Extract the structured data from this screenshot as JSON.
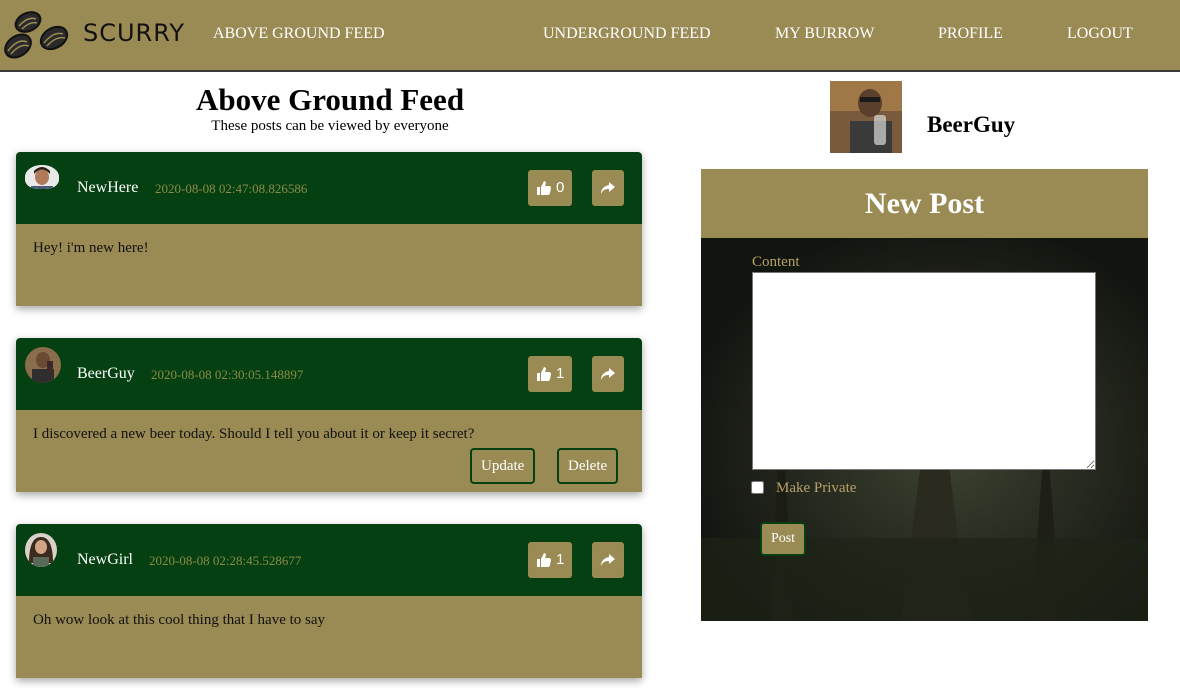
{
  "nav": {
    "brand": "SCURRY",
    "links": [
      "ABOVE GROUND FEED",
      "UNDERGROUND FEED",
      "MY BURROW",
      "PROFILE",
      "LOGOUT"
    ]
  },
  "feed": {
    "title": "Above Ground Feed",
    "subtitle": "These posts can be viewed by everyone"
  },
  "posts": [
    {
      "user": "NewHere",
      "date": "2020-08-08 02:47:08.826586",
      "likes": "0",
      "content": "Hey! i'm new here!"
    },
    {
      "user": "BeerGuy",
      "date": "2020-08-08 02:30:05.148897",
      "likes": "1",
      "content": "I discovered a new beer today. Should I tell you about it or keep it secret?",
      "update_label": "Update",
      "delete_label": "Delete"
    },
    {
      "user": "NewGirl",
      "date": "2020-08-08 02:28:45.528677",
      "likes": "1",
      "content": "Oh wow look at this cool thing that I have to say"
    }
  ],
  "profile": {
    "name": "BeerGuy"
  },
  "new_post": {
    "title": "New Post",
    "content_label": "Content",
    "private_label": "Make Private",
    "post_label": "Post"
  },
  "colors": {
    "nav": "#9a8a53",
    "post_header": "#054012",
    "post_body": "#9a8a53"
  }
}
